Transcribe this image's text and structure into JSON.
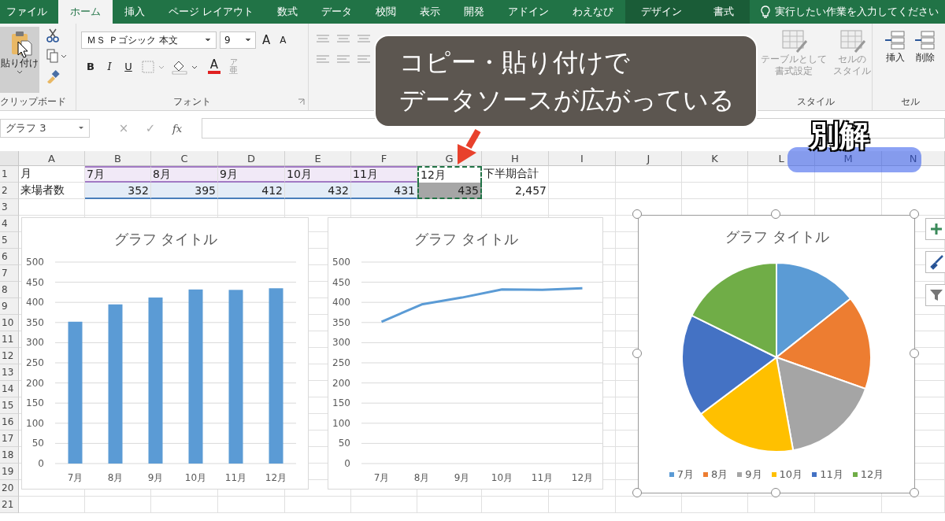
{
  "tabs": [
    {
      "label": "ファイル",
      "kind": "file",
      "selected": false
    },
    {
      "label": "ホーム",
      "kind": "tab",
      "selected": true
    },
    {
      "label": "挿入",
      "kind": "tab",
      "selected": false
    },
    {
      "label": "ページ レイアウト",
      "kind": "tab",
      "selected": false
    },
    {
      "label": "数式",
      "kind": "tab",
      "selected": false
    },
    {
      "label": "データ",
      "kind": "tab",
      "selected": false
    },
    {
      "label": "校閲",
      "kind": "tab",
      "selected": false
    },
    {
      "label": "表示",
      "kind": "tab",
      "selected": false
    },
    {
      "label": "開発",
      "kind": "tab",
      "selected": false
    },
    {
      "label": "アドイン",
      "kind": "tab",
      "selected": false
    },
    {
      "label": "わえなび",
      "kind": "tab",
      "selected": false
    },
    {
      "label": "デザイン",
      "kind": "contextual",
      "selected": false
    },
    {
      "label": "書式",
      "kind": "contextual",
      "selected": false
    }
  ],
  "tell_me": {
    "placeholder": "実行したい作業を入力してください"
  },
  "ribbon": {
    "clipboard": {
      "paste": "貼り付け",
      "label": "クリップボード"
    },
    "font": {
      "name": "ＭＳ Ｐゴシック 本文",
      "size": "9",
      "size_buttons": [
        "A",
        "A"
      ],
      "style_buttons": [
        "B",
        "I",
        "U"
      ],
      "color_button": "A",
      "phonetic_ruby": "ア",
      "phonetic": "亜",
      "label": "フォント"
    },
    "styles": {
      "buttons": [
        {
          "lines": [
            "テーブルとして",
            "書式設定"
          ]
        },
        {
          "lines": [
            "セルの",
            "スタイル"
          ]
        }
      ],
      "label": "スタイル"
    },
    "cells": {
      "buttons": [
        "挿入",
        "削除"
      ],
      "label": "セル"
    }
  },
  "callout": {
    "lines": [
      "コピー・貼り付けで",
      "データソースが広がっている"
    ]
  },
  "badge": {
    "label": "別解"
  },
  "formula_bar": {
    "name_box": "グラフ 3",
    "buttons": [
      "×",
      "✓",
      "fx"
    ]
  },
  "sheet": {
    "columns": [
      "A",
      "B",
      "C",
      "D",
      "E",
      "F",
      "G",
      "H",
      "I",
      "J",
      "K",
      "L",
      "M",
      "N"
    ],
    "rows": [
      {
        "number": "1",
        "cells": [
          {
            "text": "月",
            "kind": "label"
          },
          {
            "text": "7月",
            "kind": "series_name"
          },
          {
            "text": "8月",
            "kind": "series_name"
          },
          {
            "text": "9月",
            "kind": "series_name"
          },
          {
            "text": "10月",
            "kind": "series_name"
          },
          {
            "text": "11月",
            "kind": "series_name"
          },
          {
            "text": "12月",
            "kind": "copied_name"
          },
          {
            "text": "下半期合計",
            "kind": "label"
          }
        ]
      },
      {
        "number": "2",
        "cells": [
          {
            "text": "来場者数",
            "kind": "label"
          },
          {
            "text": "352",
            "kind": "value"
          },
          {
            "text": "395",
            "kind": "value"
          },
          {
            "text": "412",
            "kind": "value"
          },
          {
            "text": "432",
            "kind": "value"
          },
          {
            "text": "431",
            "kind": "value"
          },
          {
            "text": "435",
            "kind": "copied_value"
          },
          {
            "text": "2,457",
            "kind": "total"
          }
        ]
      },
      {
        "number": "3"
      },
      {
        "number": "4"
      },
      {
        "number": "5"
      },
      {
        "number": "6"
      },
      {
        "number": "7"
      },
      {
        "number": "8"
      },
      {
        "number": "9"
      },
      {
        "number": "10"
      },
      {
        "number": "11"
      },
      {
        "number": "12"
      },
      {
        "number": "13"
      },
      {
        "number": "14"
      },
      {
        "number": "15"
      },
      {
        "number": "16"
      },
      {
        "number": "17"
      },
      {
        "number": "18"
      },
      {
        "number": "19"
      },
      {
        "number": "20"
      },
      {
        "number": "21"
      }
    ]
  },
  "charts": [
    {
      "selected": false,
      "chart_data": {
        "type": "bar",
        "title": "グラフ タイトル",
        "grid": true,
        "categories": [
          "7月",
          "8月",
          "9月",
          "10月",
          "11月",
          "12月"
        ],
        "values": [
          352,
          395,
          412,
          432,
          431,
          435
        ],
        "ylim": [
          0,
          500
        ],
        "yticks": [
          0,
          50,
          100,
          150,
          200,
          250,
          300,
          350,
          400,
          450,
          500
        ]
      }
    },
    {
      "selected": false,
      "chart_data": {
        "type": "line",
        "title": "グラフ タイトル",
        "grid": true,
        "categories": [
          "7月",
          "8月",
          "9月",
          "10月",
          "11月",
          "12月"
        ],
        "values": [
          352,
          395,
          412,
          432,
          431,
          435
        ],
        "ylim": [
          0,
          500
        ],
        "yticks": [
          0,
          50,
          100,
          150,
          200,
          250,
          300,
          350,
          400,
          450,
          500
        ]
      }
    },
    {
      "selected": true,
      "chart_data": {
        "type": "pie",
        "title": "グラフ タイトル",
        "legend": "bottom",
        "categories": [
          "7月",
          "8月",
          "9月",
          "10月",
          "11月",
          "12月"
        ],
        "values": [
          14.33,
          16.08,
          16.77,
          17.58,
          17.54,
          17.7
        ]
      }
    }
  ]
}
